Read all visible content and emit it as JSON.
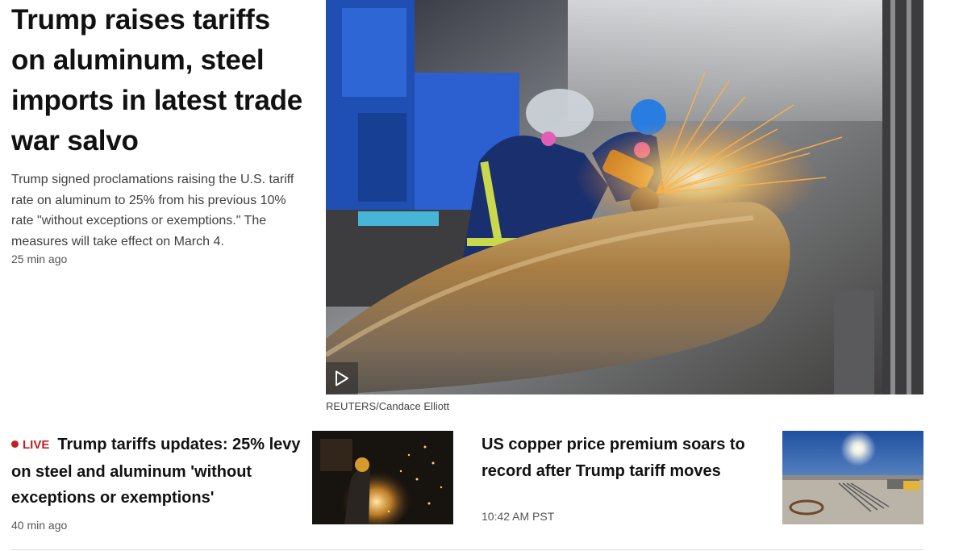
{
  "lead": {
    "title": "Trump raises tariffs on aluminum, steel imports in latest trade war salvo",
    "summary": "Trump signed proclamations raising the U.S. tariff rate on aluminum to 25% from his previous 10% rate \"without exceptions or exemptions.\" The measures will take effect on March 4.",
    "time": "25 min ago",
    "image_caption": "REUTERS/Candace Elliott",
    "media_icon": "play-icon"
  },
  "stories": [
    {
      "badge": "LIVE",
      "title": "Trump tariffs updates: 25% levy on steel and aluminum 'without exceptions or exemptions'",
      "time": "40 min ago"
    },
    {
      "title": "US copper price premium soars to record after Trump tariff moves",
      "time": "10:42 AM PST"
    }
  ],
  "colors": {
    "live": "#c41e1e",
    "text": "#111111",
    "muted": "#555555",
    "divider": "#d9d9d9"
  }
}
